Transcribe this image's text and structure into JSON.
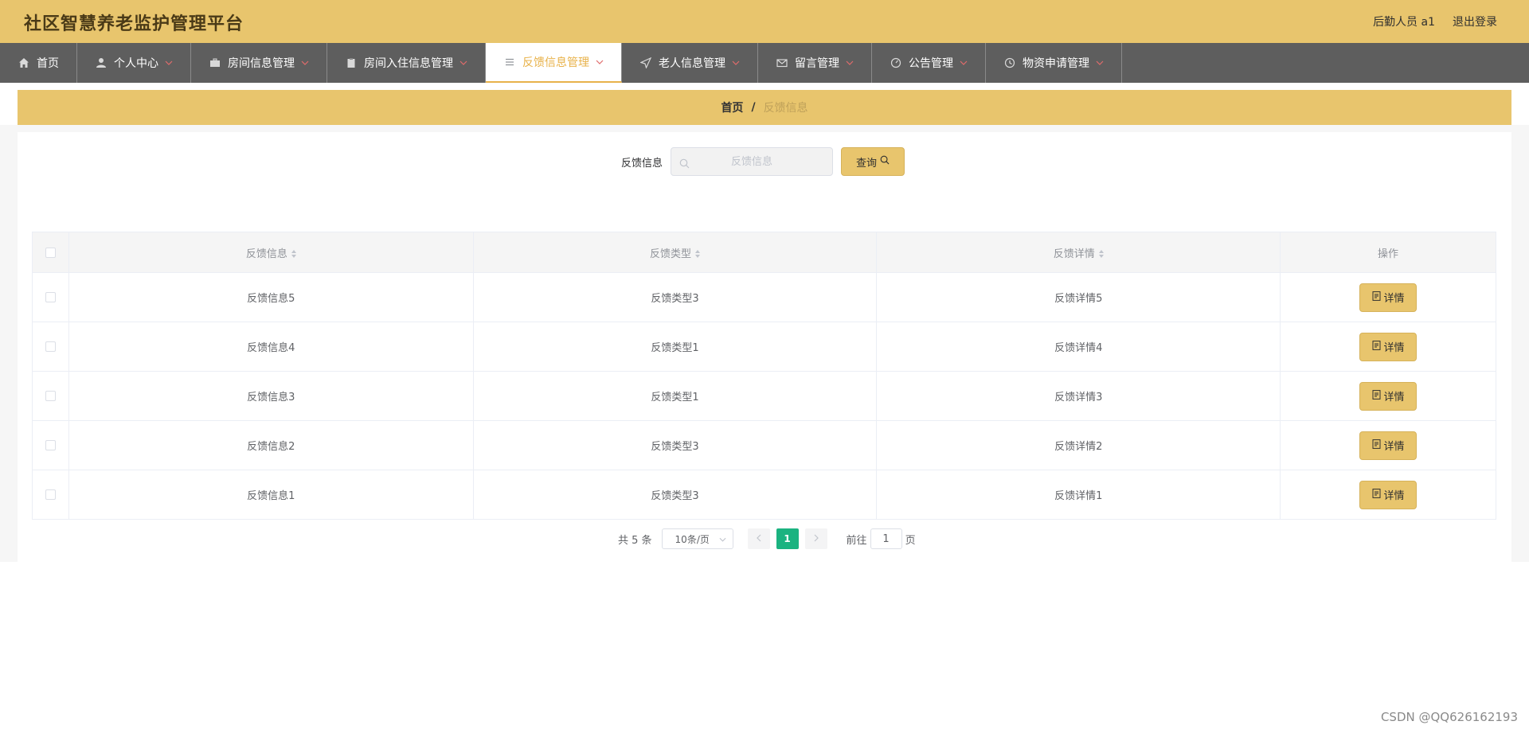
{
  "header": {
    "title": "社区智慧养老监护管理平台",
    "user": "后勤人员 a1",
    "logout": "退出登录"
  },
  "nav": {
    "items": [
      {
        "label": "首页",
        "icon": "home-icon"
      },
      {
        "label": "个人中心",
        "icon": "person-icon"
      },
      {
        "label": "房间信息管理",
        "icon": "briefcase-icon"
      },
      {
        "label": "房间入住信息管理",
        "icon": "clipboard-icon"
      },
      {
        "label": "反馈信息管理",
        "icon": "menu-icon"
      },
      {
        "label": "老人信息管理",
        "icon": "send-icon"
      },
      {
        "label": "留言管理",
        "icon": "mail-icon"
      },
      {
        "label": "公告管理",
        "icon": "gauge-icon"
      },
      {
        "label": "物资申请管理",
        "icon": "clock-icon"
      }
    ],
    "active_index": 4
  },
  "breadcrumb": {
    "home": "首页",
    "separator": "/",
    "current": "反馈信息"
  },
  "search": {
    "label": "反馈信息",
    "placeholder": "反馈信息",
    "button": "查询"
  },
  "table": {
    "headers": [
      "反馈信息",
      "反馈类型",
      "反馈详情",
      "操作"
    ],
    "action_label": "详情",
    "rows": [
      {
        "info": "反馈信息5",
        "type": "反馈类型3",
        "detail": "反馈详情5"
      },
      {
        "info": "反馈信息4",
        "type": "反馈类型1",
        "detail": "反馈详情4"
      },
      {
        "info": "反馈信息3",
        "type": "反馈类型1",
        "detail": "反馈详情3"
      },
      {
        "info": "反馈信息2",
        "type": "反馈类型3",
        "detail": "反馈详情2"
      },
      {
        "info": "反馈信息1",
        "type": "反馈类型3",
        "detail": "反馈详情1"
      }
    ]
  },
  "pagination": {
    "total": "共 5 条",
    "page_size": "10条/页",
    "current_page": "1",
    "goto_prefix": "前往",
    "goto_value": "1",
    "goto_suffix": "页"
  },
  "watermark": "CSDN @QQ626162193",
  "colors": {
    "header_bg": "#e8c56d",
    "nav_bg": "#5e5e5e",
    "accent": "#e8b24a",
    "page_active": "#1bb380"
  }
}
